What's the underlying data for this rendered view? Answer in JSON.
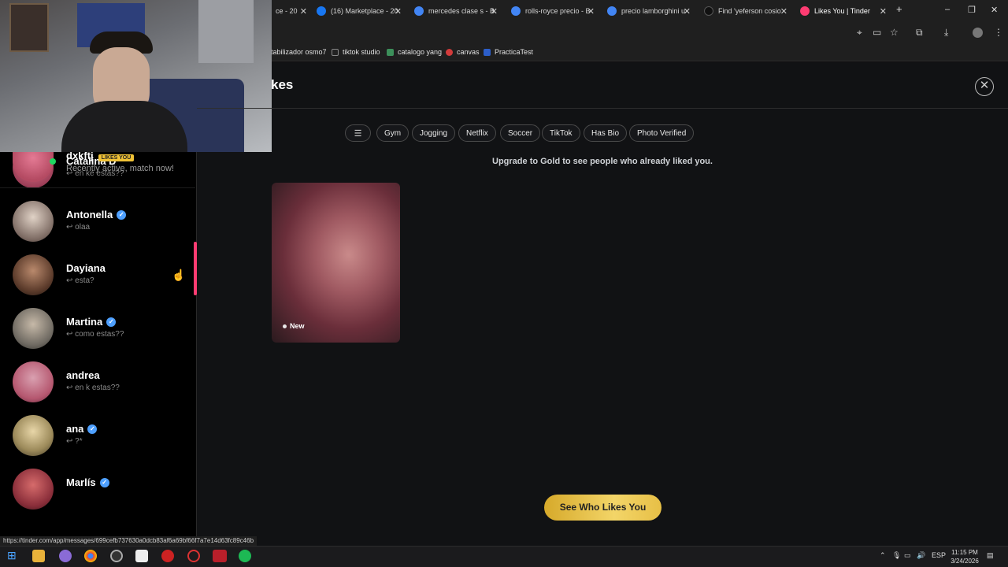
{
  "browser": {
    "tabs": [
      {
        "label": "ce - 20",
        "color": "#1f1f1f"
      },
      {
        "label": "(16) Marketplace - 20",
        "color": "#1877f2"
      },
      {
        "label": "mercedes clase s - B",
        "color": "#4285f4"
      },
      {
        "label": "rolls-royce precio - B",
        "color": "#4285f4"
      },
      {
        "label": "precio lamborghini u",
        "color": "#4285f4"
      },
      {
        "label": "Find 'yeferson cosio",
        "color": "#111111"
      },
      {
        "label": "Likes You | Tinder",
        "color": "#fe3c72"
      }
    ],
    "new_tab": "+",
    "window_buttons": [
      "–",
      "❐",
      "✕"
    ],
    "bookmarks": [
      {
        "label": "tabilizador osmo7",
        "icon": "folder-icon"
      },
      {
        "label": "tiktok studio",
        "icon": "tiktok-icon"
      },
      {
        "label": "catalogo yang",
        "icon": "link-icon"
      },
      {
        "label": "canvas",
        "icon": "canvas-icon"
      },
      {
        "label": "PracticaTest",
        "icon": "page-icon"
      }
    ],
    "status_url": "https://tinder.com/app/messages/699cefb737630a0dcb83af6a69bf66f7a7e14d63fc89c46b"
  },
  "sidebar": {
    "messages": [
      {
        "name": "dxkftj",
        "badge": "LIKES YOU",
        "preview": "Recently active, match now!",
        "verified": false,
        "online": true
      },
      {
        "name": "Catalina D",
        "preview": "↩ en ke estas??",
        "verified": false
      },
      {
        "name": "Antonella",
        "preview": "↩ olaa",
        "verified": true
      },
      {
        "name": "Dayiana",
        "preview": "↩ esta?",
        "verified": false
      },
      {
        "name": "Martina",
        "preview": "↩ como estas??",
        "verified": true
      },
      {
        "name": "andrea",
        "preview": "↩ en k estas??",
        "verified": false
      },
      {
        "name": "ana",
        "preview": "↩ ?*",
        "verified": true
      },
      {
        "name": "Marlís",
        "preview": "",
        "verified": true
      }
    ]
  },
  "main": {
    "title_partial": "kes",
    "filters": [
      "Gym",
      "Jogging",
      "Netflix",
      "Soccer",
      "TikTok",
      "Has Bio",
      "Photo Verified"
    ],
    "upgrade_text": "Upgrade to Gold to see people who already liked you.",
    "card_tag": "New",
    "cta_label": "See Who Likes You"
  },
  "taskbar": {
    "language": "ESP",
    "time": "11:15 PM",
    "date": "3/24/2026"
  },
  "colors": {
    "accent": "#fe3c72",
    "gold": "#e7bf46",
    "verified": "#4ea0ff"
  }
}
